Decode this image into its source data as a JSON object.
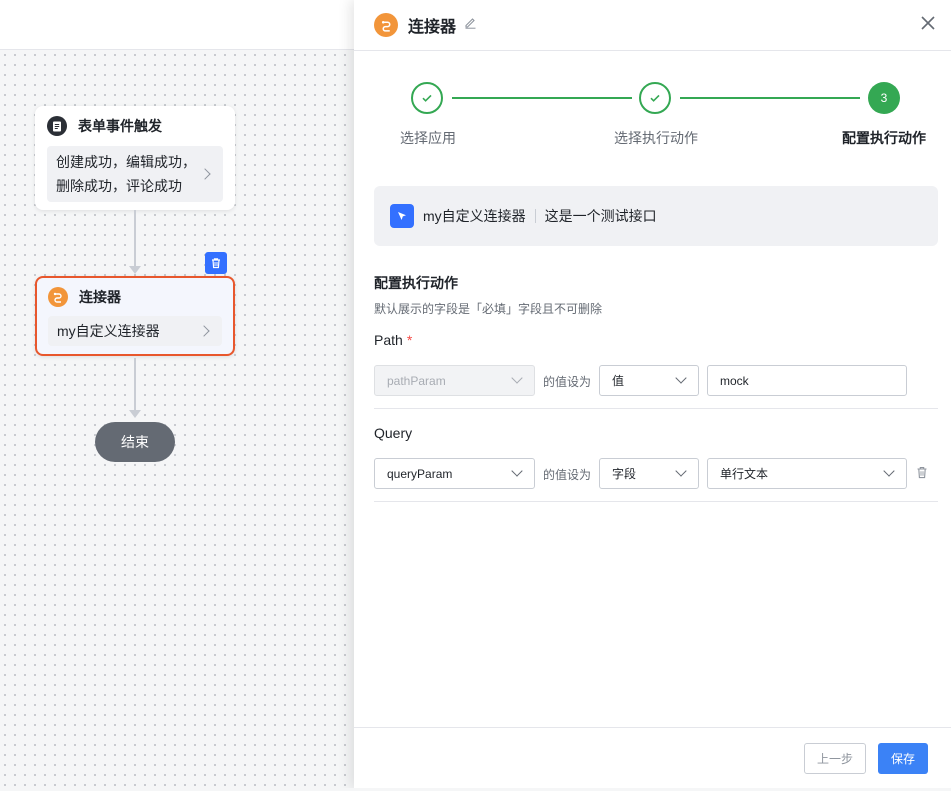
{
  "canvas": {
    "trigger_node": {
      "title": "表单事件触发",
      "body_line1": "创建成功，编辑成功，",
      "body_line2": "删除成功，评论成功"
    },
    "connector_node": {
      "title": "连接器",
      "body": "my自定义连接器"
    },
    "end_node": {
      "label": "结束"
    }
  },
  "drawer": {
    "title": "连接器",
    "steps": [
      {
        "label": "选择应用",
        "status": "done"
      },
      {
        "label": "选择执行动作",
        "status": "done"
      },
      {
        "label": "配置执行动作",
        "status": "active",
        "number": "3"
      }
    ],
    "app_card": {
      "name": "my自定义连接器",
      "description": "这是一个测试接口"
    },
    "section": {
      "title": "配置执行动作",
      "hint": "默认展示的字段是「必填」字段且不可删除"
    },
    "path": {
      "label": "Path",
      "required_mark": "*",
      "param": "pathParam",
      "value_as": "的值设为",
      "type": "值",
      "value": "mock"
    },
    "query": {
      "label": "Query",
      "param": "queryParam",
      "value_as": "的值设为",
      "type": "字段",
      "value": "单行文本"
    },
    "footer": {
      "prev_label": "上一步",
      "save_label": "保存"
    }
  },
  "colors": {
    "accent": "#3370ff",
    "success": "#34a853",
    "connector_border": "#e8572c",
    "connector_icon": "#f2953a"
  }
}
